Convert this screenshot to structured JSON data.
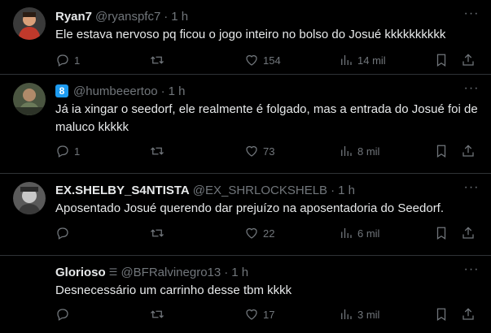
{
  "tweets": [
    {
      "name": "Ryan7",
      "handle": "@ryanspfc7",
      "time": "1 h",
      "text": "Ele estava nervoso pq ficou o jogo inteiro no bolso do Josué kkkkkkkkkk",
      "replies": "1",
      "likes": "154",
      "views": "14 mil",
      "avatar_color": "#c0392b"
    },
    {
      "name": "",
      "badge": "8",
      "handle": "@humbeeertoo",
      "time": "1 h",
      "text": "Já ia xingar o seedorf, ele realmente é folgado, mas a entrada do Josué foi de maluco kkkkk",
      "replies": "1",
      "likes": "73",
      "views": "8 mil",
      "avatar_color": "#6b7a5a"
    },
    {
      "name": "EX.SHELBY_S4NTISTA",
      "handle": "@EX_SHRLOCKSHELB",
      "time": "1 h",
      "text": "Aposentado Josué querendo dar prejuízo na aposentadoria do Seedorf.",
      "replies": "",
      "likes": "22",
      "views": "6 mil",
      "avatar_color": "#8a8a8a"
    },
    {
      "name": "Glorioso",
      "flag": "☰",
      "handle": "@BFRalvinegro13",
      "time": "1 h",
      "text": "Desnecessário um carrinho desse tbm kkkk",
      "replies": "",
      "likes": "17",
      "views": "3 mil",
      "avatar_color": "#111111"
    }
  ],
  "separator": "·",
  "more_label": "···",
  "colors": {
    "background": "#000000",
    "text": "#e7e9ea",
    "muted": "#71767b",
    "border": "#2f3336",
    "accent": "#1d9bf0"
  },
  "icons": [
    "reply-icon",
    "retweet-icon",
    "like-icon",
    "views-icon",
    "bookmark-icon",
    "share-icon",
    "more-icon"
  ]
}
